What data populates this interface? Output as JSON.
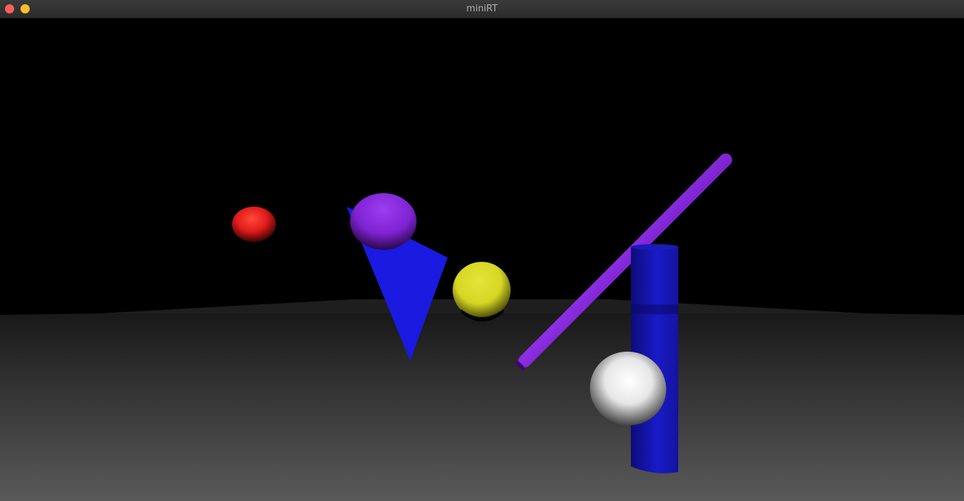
{
  "window": {
    "title": "miniRT",
    "buttons": [
      {
        "name": "close",
        "color": "#ff5f57"
      },
      {
        "name": "minimize",
        "color": "#febc2e"
      }
    ]
  },
  "scene": {
    "background_color": "#000000",
    "floor_colors": {
      "near": "#5a5a5a",
      "far": "#141414"
    },
    "objects": [
      {
        "type": "sphere",
        "name": "red-sphere",
        "color": "#e01a1a"
      },
      {
        "type": "sphere",
        "name": "purple-sphere",
        "color": "#7e22d2"
      },
      {
        "type": "triangle",
        "name": "blue-triangle",
        "color": "#1a1ae0"
      },
      {
        "type": "sphere",
        "name": "yellow-sphere",
        "color": "#d6d624"
      },
      {
        "type": "cylinder",
        "name": "purple-cylinder",
        "color": "#7a22cc"
      },
      {
        "type": "cylinder",
        "name": "blue-cylinder",
        "color": "#1a1ac8"
      },
      {
        "type": "sphere",
        "name": "white-sphere",
        "color": "#ffffff"
      }
    ]
  }
}
